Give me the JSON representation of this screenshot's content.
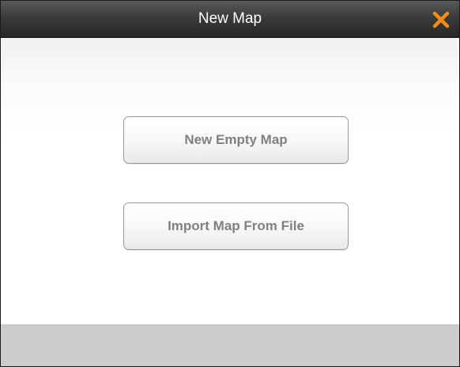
{
  "dialog": {
    "title": "New Map",
    "close_icon": "close-x-icon",
    "accent_color": "#f28c1a"
  },
  "actions": {
    "new_empty_label": "New Empty Map",
    "import_label": "Import Map From File"
  }
}
